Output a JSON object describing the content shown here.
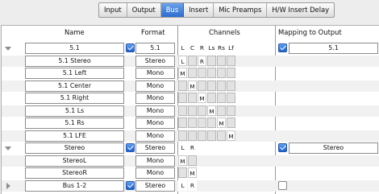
{
  "tabs": [
    {
      "label": "Input",
      "active": false
    },
    {
      "label": "Output",
      "active": false
    },
    {
      "label": "Bus",
      "active": true
    },
    {
      "label": "Insert",
      "active": false
    },
    {
      "label": "Mic Preamps",
      "active": false
    },
    {
      "label": "H/W Insert Delay",
      "active": false
    }
  ],
  "headers": {
    "name": "Name",
    "format": "Format",
    "channels": "Channels",
    "mapping": "Mapping to Output"
  },
  "channel_labels": [
    "L",
    "C",
    "R",
    "Ls",
    "Rs",
    "Lf"
  ],
  "colors": {
    "accent": "#2d6cd0",
    "grid_fill": "#e2e2e2"
  },
  "rows": [
    {
      "name": "5.1",
      "format": "5.1",
      "expander": "down",
      "checked": true,
      "cells": [
        "L",
        "C",
        "R",
        "Ls",
        "Rs",
        "Lf"
      ],
      "cell_style": "labels",
      "mapping_checked": true,
      "mapping": "5.1",
      "shade": false
    },
    {
      "name": "5.1 Stereo",
      "format": "Stereo",
      "expander": null,
      "checked": null,
      "cells": [
        "L",
        "",
        "R",
        "",
        "",
        ""
      ],
      "cell_style": "grid",
      "mapping_checked": null,
      "mapping": null,
      "shade": true
    },
    {
      "name": "5.1 Left",
      "format": "Mono",
      "expander": null,
      "checked": null,
      "cells": [
        "M",
        "",
        "",
        "",
        "",
        ""
      ],
      "cell_style": "grid",
      "mapping_checked": null,
      "mapping": null,
      "shade": false
    },
    {
      "name": "5.1 Center",
      "format": "Mono",
      "expander": null,
      "checked": null,
      "cells": [
        "",
        "M",
        "",
        "",
        "",
        ""
      ],
      "cell_style": "grid",
      "mapping_checked": null,
      "mapping": null,
      "shade": true
    },
    {
      "name": "5.1 Right",
      "format": "Mono",
      "expander": null,
      "checked": null,
      "cells": [
        "",
        "",
        "M",
        "",
        "",
        ""
      ],
      "cell_style": "grid",
      "mapping_checked": null,
      "mapping": null,
      "shade": false
    },
    {
      "name": "5.1 Ls",
      "format": "Mono",
      "expander": null,
      "checked": null,
      "cells": [
        "",
        "",
        "",
        "M",
        "",
        ""
      ],
      "cell_style": "grid",
      "mapping_checked": null,
      "mapping": null,
      "shade": true
    },
    {
      "name": "5.1 Rs",
      "format": "Mono",
      "expander": null,
      "checked": null,
      "cells": [
        "",
        "",
        "",
        "",
        "M",
        ""
      ],
      "cell_style": "grid",
      "mapping_checked": null,
      "mapping": null,
      "shade": false
    },
    {
      "name": "5.1 LFE",
      "format": "Mono",
      "expander": null,
      "checked": null,
      "cells": [
        "",
        "",
        "",
        "",
        "",
        "M"
      ],
      "cell_style": "grid",
      "mapping_checked": null,
      "mapping": null,
      "shade": true
    },
    {
      "name": "Stereo",
      "format": "Stereo",
      "expander": "down",
      "checked": true,
      "cells": [
        "L",
        "R"
      ],
      "cell_style": "labels2",
      "mapping_checked": true,
      "mapping": "Stereo",
      "shade": false
    },
    {
      "name": "StereoL",
      "format": "Mono",
      "expander": null,
      "checked": null,
      "cells": [
        "M",
        ""
      ],
      "cell_style": "grid2",
      "mapping_checked": null,
      "mapping": null,
      "shade": true
    },
    {
      "name": "StereoR",
      "format": "Mono",
      "expander": null,
      "checked": null,
      "cells": [
        "",
        "M"
      ],
      "cell_style": "grid2",
      "mapping_checked": null,
      "mapping": null,
      "shade": false
    },
    {
      "name": "Bus 1-2",
      "format": "Stereo",
      "expander": "right",
      "checked": true,
      "cells": [
        "L",
        "R"
      ],
      "cell_style": "labels2",
      "mapping_checked": false,
      "mapping": null,
      "shade": true
    }
  ]
}
